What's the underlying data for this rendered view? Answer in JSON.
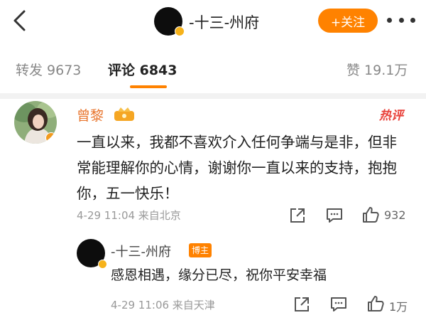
{
  "header": {
    "title": "-十三-州府",
    "follow_label": "+关注",
    "back_icon": "chevron-left-icon",
    "more_icon": "more-horizontal-icon"
  },
  "tabs": [
    {
      "label": "转发 9673"
    },
    {
      "label": "评论 6843"
    },
    {
      "label": "赞 19.1万"
    }
  ],
  "comment": {
    "author": "曾黎",
    "hot_badge": "热评",
    "text": "一直以来，我都不喜欢介入任何争端与是非，但非常能理解你的心情，谢谢你一直以来的支持，抱抱你，五一快乐！",
    "meta": "4-29 11:04 来自北京",
    "like_count": "932",
    "reply": {
      "author": "-十三-州府",
      "badge": "博主",
      "text": "感恩相遇，缘分已尽，祝你平安幸福",
      "meta": "4-29 11:06 来自天津",
      "like_count": "1万"
    }
  },
  "colors": {
    "accent": "#ff8200",
    "username": "#e8742c",
    "hot": "#e9423b",
    "muted": "#999999"
  }
}
